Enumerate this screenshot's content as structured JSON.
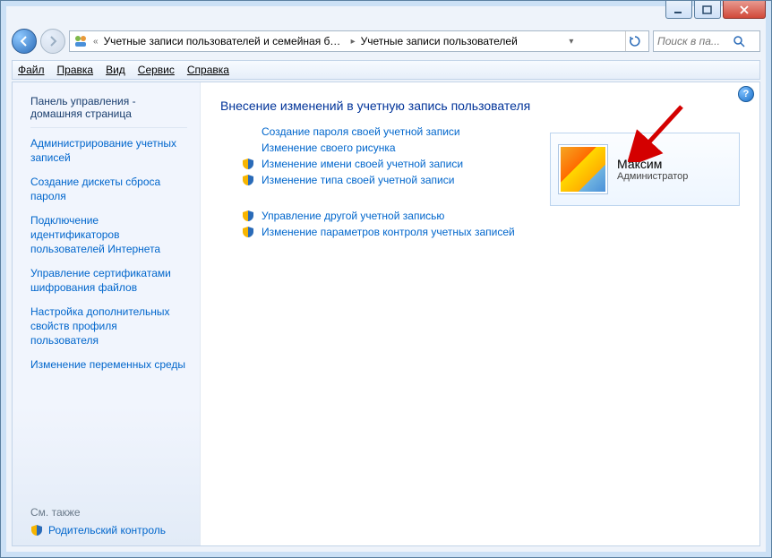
{
  "titlebar": {
    "minimize": "minimize",
    "maximize": "maximize",
    "close": "close"
  },
  "breadcrumb": {
    "seg1": "Учетные записи пользователей и семейная безоп...",
    "seg2": "Учетные записи пользователей"
  },
  "search": {
    "placeholder": "Поиск в па..."
  },
  "menu": {
    "file": "Файл",
    "edit": "Правка",
    "view": "Вид",
    "tools": "Сервис",
    "help": "Справка"
  },
  "sidebar": {
    "home": "Панель управления - домашняя страница",
    "links": [
      "Администрирование учетных записей",
      "Создание дискеты сброса пароля",
      "Подключение идентификаторов пользователей Интернета",
      "Управление сертификатами шифрования файлов",
      "Настройка дополнительных свойств профиля пользователя",
      "Изменение переменных среды"
    ],
    "see_also": "См. также",
    "parental": "Родительский контроль"
  },
  "main": {
    "heading": "Внесение изменений в учетную запись пользователя",
    "tasks": [
      {
        "label": "Создание пароля своей учетной записи",
        "shield": false
      },
      {
        "label": "Изменение своего рисунка",
        "shield": false
      },
      {
        "label": "Изменение имени своей учетной записи",
        "shield": true
      },
      {
        "label": "Изменение типа своей учетной записи",
        "shield": true
      }
    ],
    "tasks2": [
      {
        "label": "Управление другой учетной записью",
        "shield": true
      },
      {
        "label": "Изменение параметров контроля учетных записей",
        "shield": true
      }
    ]
  },
  "user": {
    "name": "Максим",
    "role": "Администратор"
  }
}
